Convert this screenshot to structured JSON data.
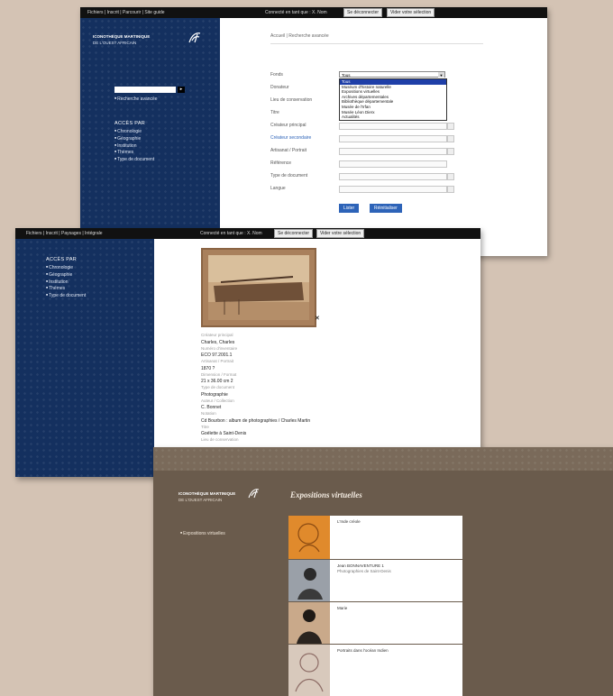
{
  "s1": {
    "topbar": {
      "links": "Fichiers | Inscrit | Parcourir | Site guide",
      "connected": "Connecté en tant que : X. Nom",
      "btn1": "Se déconnecter",
      "btn2": "Vider votre sélection"
    },
    "logo": {
      "line1": "ICONOTHÈQUE MARTINIQUE",
      "line2": "DE L'OUEST AFRICAIN"
    },
    "search_link": "Recherche avancée",
    "menu": {
      "title": "ACCÈS PAR",
      "items": [
        "Chronologie",
        "Géographie",
        "Institution",
        "Thèmes",
        "Type de document"
      ]
    },
    "breadcrumb": {
      "home": "Accueil",
      "current": "Recherche avancée"
    },
    "fields": [
      "Fonds",
      "Donateur",
      "Lieu de conservation",
      "Titre",
      "Créateur principal",
      "Créateur secondaire",
      "Artisanat / Portrait",
      "Référence",
      "Type de document",
      "Langue"
    ],
    "dropdown": {
      "selected": "Tous",
      "options": [
        "Tous",
        "Muséum d'histoire naturelle",
        "Expositions virtuelles",
        "Archives départementales",
        "Bibliothèque départementale",
        "Musée de l'Irfan",
        "Musée Léon Dierx",
        "Actualités"
      ]
    },
    "buttons": {
      "search": "Lister",
      "reset": "Réinitialiser"
    }
  },
  "s2": {
    "topbar": {
      "links": "Fichiers | Inscrit | Paysages | Intégrale",
      "connected": "Connecté en tant que : X. Nom",
      "btn1": "Se déconnecter",
      "btn2": "Vider votre sélection"
    },
    "menu": {
      "title": "ACCÈS PAR",
      "items": [
        "Chronologie",
        "Géographie",
        "Institution",
        "Thèmes",
        "Type de document"
      ]
    },
    "close": "✕",
    "meta": [
      {
        "label": "Créateur principal",
        "value": "Charles, Charles"
      },
      {
        "label": "Numéro d'inventaire",
        "value": "ECO 97.2001.1"
      },
      {
        "label": "Artisanat / Portrait",
        "value": "1870 ?"
      },
      {
        "label": "Dimension / Format",
        "value": "21 x 36.00 cm 2"
      },
      {
        "label": "Type de document",
        "value": "Photographie"
      },
      {
        "label": "Auteur / Collection",
        "value": "C. Bonnet"
      },
      {
        "label": "Notation",
        "value": "Cd Bourbon : album de photographies / Charles Martin"
      },
      {
        "label": "Titre",
        "value": "Goélette à Saint-Denis"
      },
      {
        "label": "Lieu de conservation",
        "value": ""
      }
    ]
  },
  "s3": {
    "logo": {
      "line1": "ICONOTHÈQUE MARTINIQUE",
      "line2": "DE L'OUEST AFRICAIN"
    },
    "title": "Expositions virtuelles",
    "side_link": "Expositions virtuelles",
    "items": [
      {
        "title": "L'Inde créole",
        "subtitle": ""
      },
      {
        "title": "Jean BONNAVENTURE 1",
        "subtitle": "Photographies de Saint-Denis"
      },
      {
        "title": "Marie",
        "subtitle": ""
      },
      {
        "title": "Portraits dans l'océan Indien",
        "subtitle": ""
      }
    ]
  },
  "colors": {
    "navy": "#14305f",
    "brown": "#6a5b4c",
    "background": "#d4c3b4",
    "accent": "#2d63b8"
  }
}
